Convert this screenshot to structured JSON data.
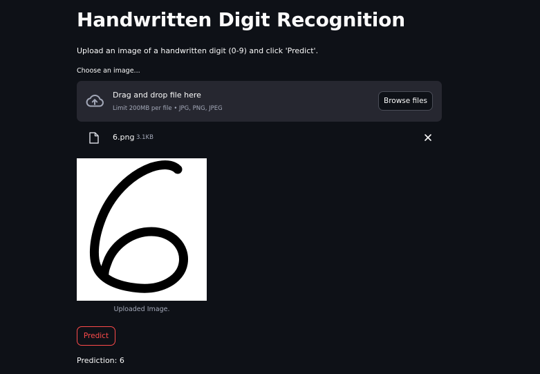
{
  "page": {
    "title": "Handwritten Digit Recognition",
    "subtitle": "Upload an image of a handwritten digit (0-9) and click 'Predict'."
  },
  "uploader": {
    "label": "Choose an image...",
    "drop_title": "Drag and drop file here",
    "drop_hint": "Limit 200MB per file • JPG, PNG, JPEG",
    "browse_label": "Browse files",
    "icon": "cloud-upload-icon"
  },
  "uploaded_file": {
    "name": "6.png",
    "size": "3.1KB",
    "icon": "file-icon",
    "remove_icon": "close-icon"
  },
  "image": {
    "caption": "Uploaded Image.",
    "depicts": "handwritten digit 6"
  },
  "actions": {
    "predict_label": "Predict"
  },
  "result": {
    "text": "Prediction: 6"
  },
  "colors": {
    "background": "#0e1117",
    "panel": "#262730",
    "accent": "#ff4b4b",
    "muted_text": "#a3a8b8"
  }
}
